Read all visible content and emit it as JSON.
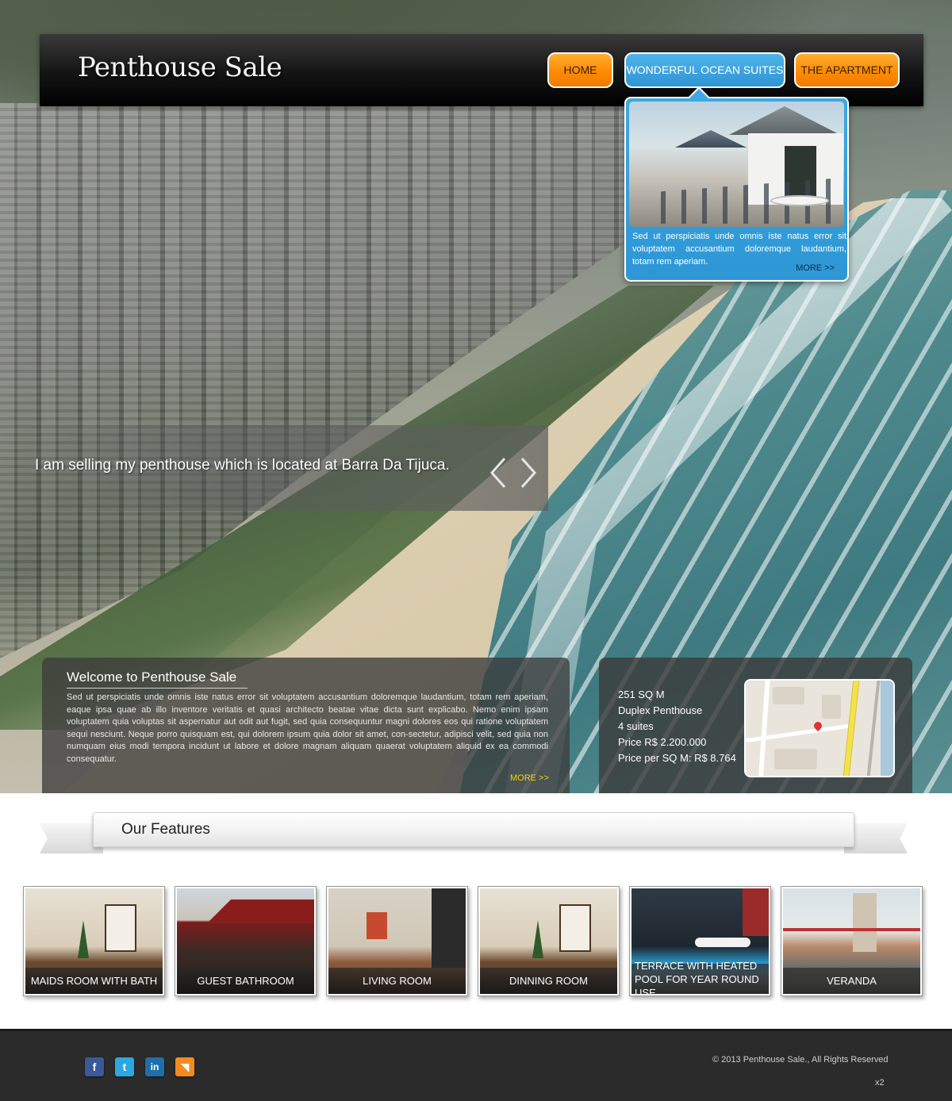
{
  "site": {
    "logo": "Penthouse Sale"
  },
  "nav": {
    "items": [
      {
        "label": "HOME",
        "style": "orange"
      },
      {
        "label": "WONDERFUL OCEAN SUITES",
        "style": "blue"
      },
      {
        "label": "THE APARTMENT",
        "style": "orange"
      }
    ]
  },
  "dropdown": {
    "text": "Sed ut perspiciatis unde omnis iste natus error sit voluptatem accusantium doloremque laudantium, totam rem aperiam.",
    "more": "MORE >>"
  },
  "slider": {
    "caption": "I am selling my penthouse which is located at Barra Da Tijuca.",
    "prev_icon": "chevron-left-icon",
    "next_icon": "chevron-right-icon"
  },
  "welcome": {
    "title": "Welcome to  Penthouse Sale",
    "text": "Sed ut perspiciatis unde omnis iste natus error sit voluptatem accusantium doloremque laudantium, totam rem aperiam, eaque ipsa quae ab illo inventore veritatis et quasi architecto beatae vitae dicta sunt explicabo. Nemo enim ipsam voluptatem quia voluptas sit aspernatur aut odit aut fugit, sed quia consequuntur magni dolores eos qui ratione voluptatem sequi nesciunt. Neque porro quisquam est, qui dolorem ipsum quia dolor sit amet, con-sectetur, adipisci velit, sed quia non numquam eius modi tempora incidunt ut labore et dolore magnam aliquam quaerat voluptatem aliquid ex ea commodi consequatur.",
    "more": "MORE >>"
  },
  "property": {
    "details": [
      "251 SQ M",
      "Duplex Penthouse",
      "4 suites",
      "Price R$ 2.200.000",
      "Price per SQ M: R$ 8.764"
    ]
  },
  "features": {
    "title": "Our Features",
    "cards": [
      {
        "label": "MAIDS ROOM WITH BATH"
      },
      {
        "label": "GUEST BATHROOM"
      },
      {
        "label": "LIVING ROOM"
      },
      {
        "label": "DINNING ROOM"
      },
      {
        "label": "TERRACE WITH HEATED POOL FOR YEAR ROUND USE"
      },
      {
        "label": "VERANDA"
      }
    ]
  },
  "footer": {
    "social": [
      {
        "icon": "facebook-icon",
        "glyph": "f",
        "color": "#3b5998"
      },
      {
        "icon": "twitter-icon",
        "glyph": "t",
        "color": "#2aa9e0"
      },
      {
        "icon": "linkedin-icon",
        "glyph": "in",
        "color": "#1f6fa8"
      },
      {
        "icon": "rss-icon",
        "glyph": "◥",
        "color": "#f48b1f"
      }
    ],
    "copyright": "© 2013 Penthouse Sale., All Rights Reserved",
    "x2": "x2"
  },
  "colors": {
    "nav_orange": "#ff8b00",
    "nav_blue": "#2e95d4",
    "more_link": "#f0d600",
    "footer_bg": "#2b2b2b"
  }
}
